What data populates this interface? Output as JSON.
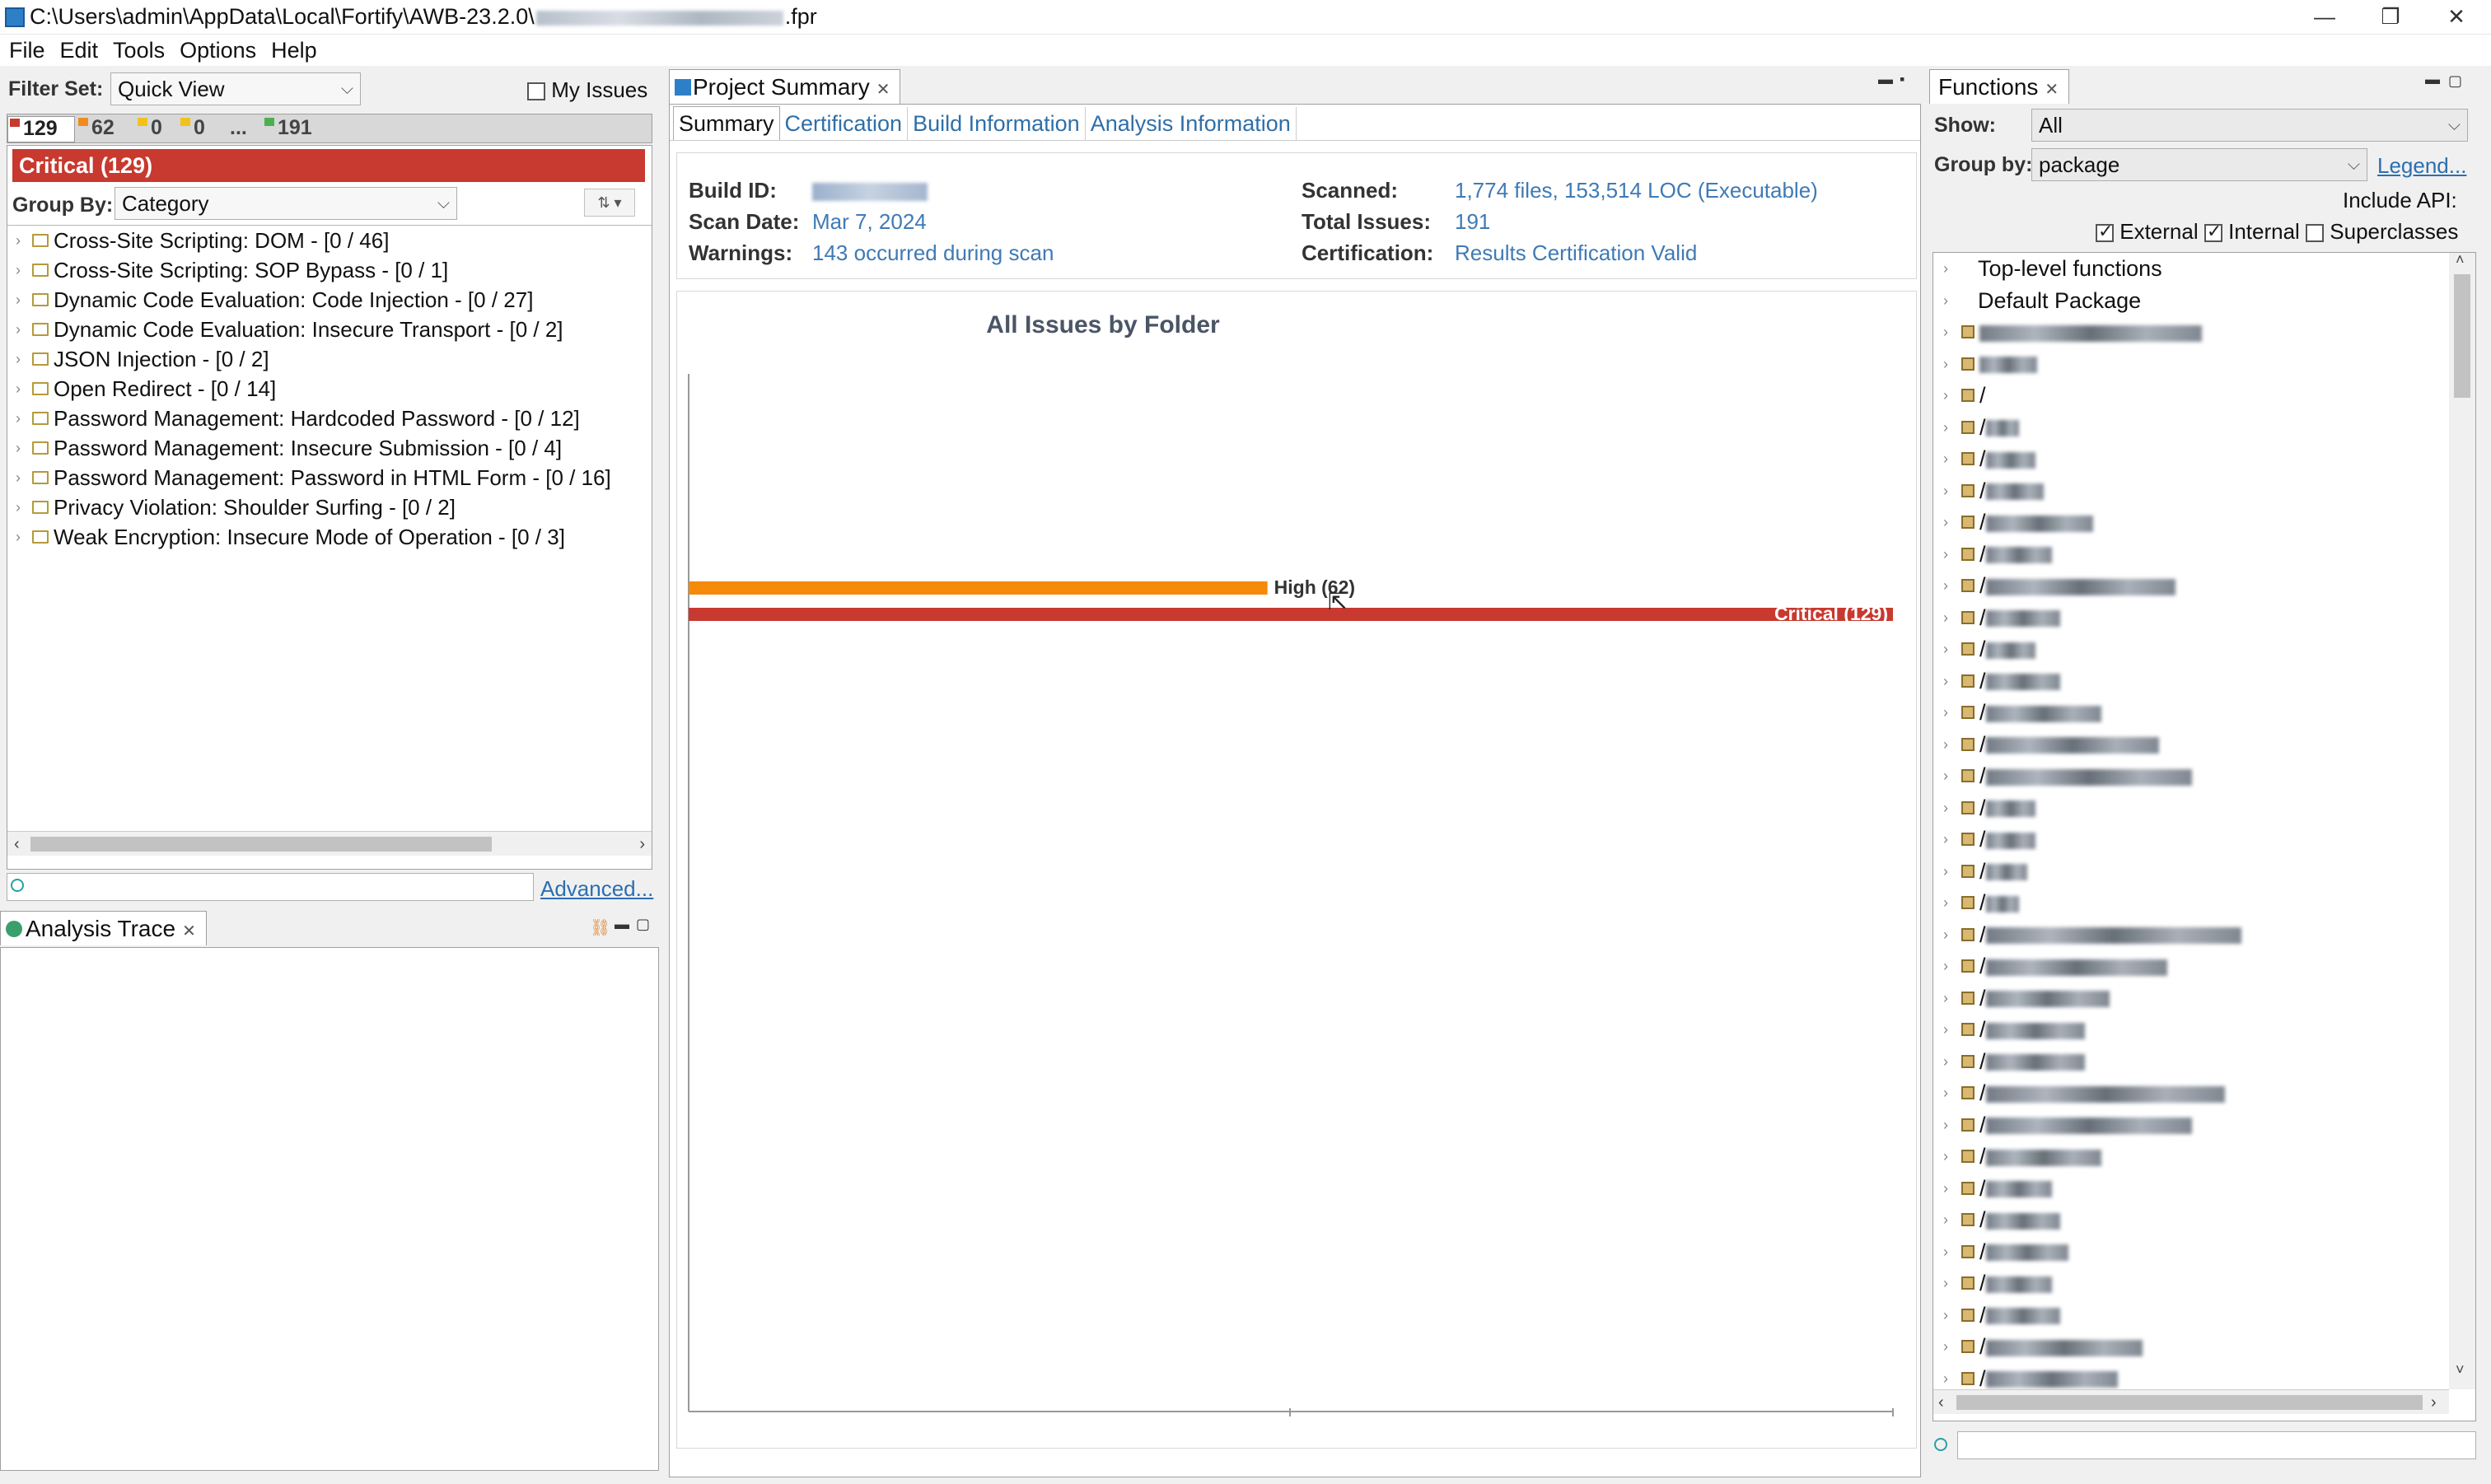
{
  "window": {
    "title_prefix": "C:\\Users\\admin\\AppData\\Local\\Fortify\\AWB-23.2.0\\",
    "title_suffix": ".fpr",
    "controls": [
      "—",
      "❐",
      "✕"
    ]
  },
  "menu": [
    "File",
    "Edit",
    "Tools",
    "Options",
    "Help"
  ],
  "issues_panel": {
    "filter_set_label": "Filter Set:",
    "filter_set_value": "Quick View",
    "my_issues_label": "My Issues",
    "folder_tabs": [
      {
        "count": "129",
        "color": "#c8392f",
        "active": true
      },
      {
        "count": "62",
        "color": "#f08c1e"
      },
      {
        "count": "0",
        "color": "#f2c21c"
      },
      {
        "count": "0",
        "color": "#f2c21c"
      },
      {
        "count": "...",
        "color": ""
      },
      {
        "count": "191",
        "color": "#4caf50"
      }
    ],
    "critical_header": "Critical (129)",
    "group_by_label": "Group By:",
    "group_by_value": "Category",
    "categories": [
      "Cross-Site Scripting: DOM - [0 / 46]",
      "Cross-Site Scripting: SOP Bypass - [0 / 1]",
      "Dynamic Code Evaluation: Code Injection - [0 / 27]",
      "Dynamic Code Evaluation: Insecure Transport - [0 / 2]",
      "JSON Injection - [0 / 2]",
      "Open Redirect - [0 / 14]",
      "Password Management: Hardcoded Password - [0 / 12]",
      "Password Management: Insecure Submission - [0 / 4]",
      "Password Management: Password in HTML Form - [0 / 16]",
      "Privacy Violation: Shoulder Surfing - [0 / 2]",
      "Weak Encryption: Insecure Mode of Operation - [0 / 3]"
    ],
    "advanced_link": "Advanced..."
  },
  "analysis_trace": {
    "tab_label": "Analysis Trace"
  },
  "project_summary": {
    "tab_label": "Project Summary",
    "subtabs": [
      "Summary",
      "Certification",
      "Build Information",
      "Analysis Information"
    ],
    "build_id_label": "Build ID:",
    "scan_date_label": "Scan Date:",
    "scan_date": "Mar 7, 2024",
    "warnings_label": "Warnings:",
    "warnings": "143 occurred during scan",
    "scanned_label": "Scanned:",
    "scanned": "1,774 files, 153,514 LOC (Executable)",
    "total_issues_label": "Total Issues:",
    "total_issues": "191",
    "certification_label": "Certification:",
    "certification": "Results Certification Valid"
  },
  "chart_data": {
    "type": "bar",
    "orientation": "horizontal",
    "title": "All Issues by Folder",
    "categories": [
      "High",
      "Critical"
    ],
    "values": [
      62,
      129
    ],
    "labels": [
      "High (62)",
      "Critical (129)"
    ],
    "colors": [
      "#f58a0b",
      "#c8392f"
    ],
    "xlim": [
      0,
      129
    ],
    "grid": false
  },
  "functions_panel": {
    "tab_label": "Functions",
    "show_label": "Show:",
    "show_value": "All",
    "group_by_label": "Group by:",
    "group_by_value": "package",
    "legend_link": "Legend...",
    "include_api_label": "Include API:",
    "external_label": "External",
    "internal_label": "Internal",
    "superclasses_label": "Superclasses",
    "external_checked": true,
    "internal_checked": true,
    "superclasses_checked": false,
    "top_items": [
      "Top-level functions",
      "Default Package"
    ],
    "package_rows": [
      {
        "text": "",
        "blur_width": 270
      },
      {
        "text": "",
        "blur_width": 70
      },
      {
        "text": "/",
        "blur_width": 0
      },
      {
        "text": "/",
        "blur_width": 40
      },
      {
        "text": "/",
        "blur_width": 60
      },
      {
        "text": "/",
        "blur_width": 70
      },
      {
        "text": "/",
        "blur_width": 130
      },
      {
        "text": "/",
        "blur_width": 80
      },
      {
        "text": "/",
        "blur_width": 230
      },
      {
        "text": "/",
        "blur_width": 90
      },
      {
        "text": "/",
        "blur_width": 60
      },
      {
        "text": "/",
        "blur_width": 90
      },
      {
        "text": "/",
        "blur_width": 140
      },
      {
        "text": "/",
        "blur_width": 210
      },
      {
        "text": "/",
        "blur_width": 250
      },
      {
        "text": "/",
        "blur_width": 60
      },
      {
        "text": "/",
        "blur_width": 60
      },
      {
        "text": "/",
        "blur_width": 50
      },
      {
        "text": "/",
        "blur_width": 40
      },
      {
        "text": "/",
        "blur_width": 310
      },
      {
        "text": "/",
        "blur_width": 220
      },
      {
        "text": "/",
        "blur_width": 150
      },
      {
        "text": "/",
        "blur_width": 120
      },
      {
        "text": "/",
        "blur_width": 120
      },
      {
        "text": "/",
        "blur_width": 290
      },
      {
        "text": "/",
        "blur_width": 250
      },
      {
        "text": "/",
        "blur_width": 140
      },
      {
        "text": "/",
        "blur_width": 80
      },
      {
        "text": "/",
        "blur_width": 90
      },
      {
        "text": "/",
        "blur_width": 100
      },
      {
        "text": "/",
        "blur_width": 80
      },
      {
        "text": "/",
        "blur_width": 90
      },
      {
        "text": "/",
        "blur_width": 190
      },
      {
        "text": "/",
        "blur_width": 160
      }
    ]
  }
}
